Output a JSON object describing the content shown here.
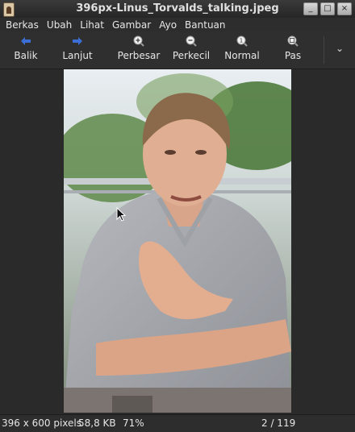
{
  "window": {
    "title": "396px-Linus_Torvalds_talking.jpeg",
    "buttons": [
      "_",
      "□",
      "×"
    ]
  },
  "menu": [
    {
      "label": "Berkas"
    },
    {
      "label": "Ubah"
    },
    {
      "label": "Lihat"
    },
    {
      "label": "Gambar"
    },
    {
      "label": "Ayo"
    },
    {
      "label": "Bantuan"
    }
  ],
  "toolbar": {
    "back": {
      "label": "Balik",
      "icon": "arrow-left-icon"
    },
    "forward": {
      "label": "Lanjut",
      "icon": "arrow-right-icon"
    },
    "zoom_in": {
      "label": "Perbesar",
      "icon": "zoom-in-icon"
    },
    "zoom_out": {
      "label": "Perkecil",
      "icon": "zoom-out-icon"
    },
    "normal": {
      "label": "Normal",
      "icon": "zoom-original-icon"
    },
    "fit": {
      "label": "Pas",
      "icon": "zoom-fit-icon"
    },
    "overflow": "⌄"
  },
  "status": {
    "dimensions": "396 x 600 pixels",
    "file_size": "58,8 KB",
    "zoom": "71%",
    "position": "2 / 119"
  },
  "colors": {
    "accent_blue": "#3b6fd6",
    "background": "#2b2b2b"
  }
}
